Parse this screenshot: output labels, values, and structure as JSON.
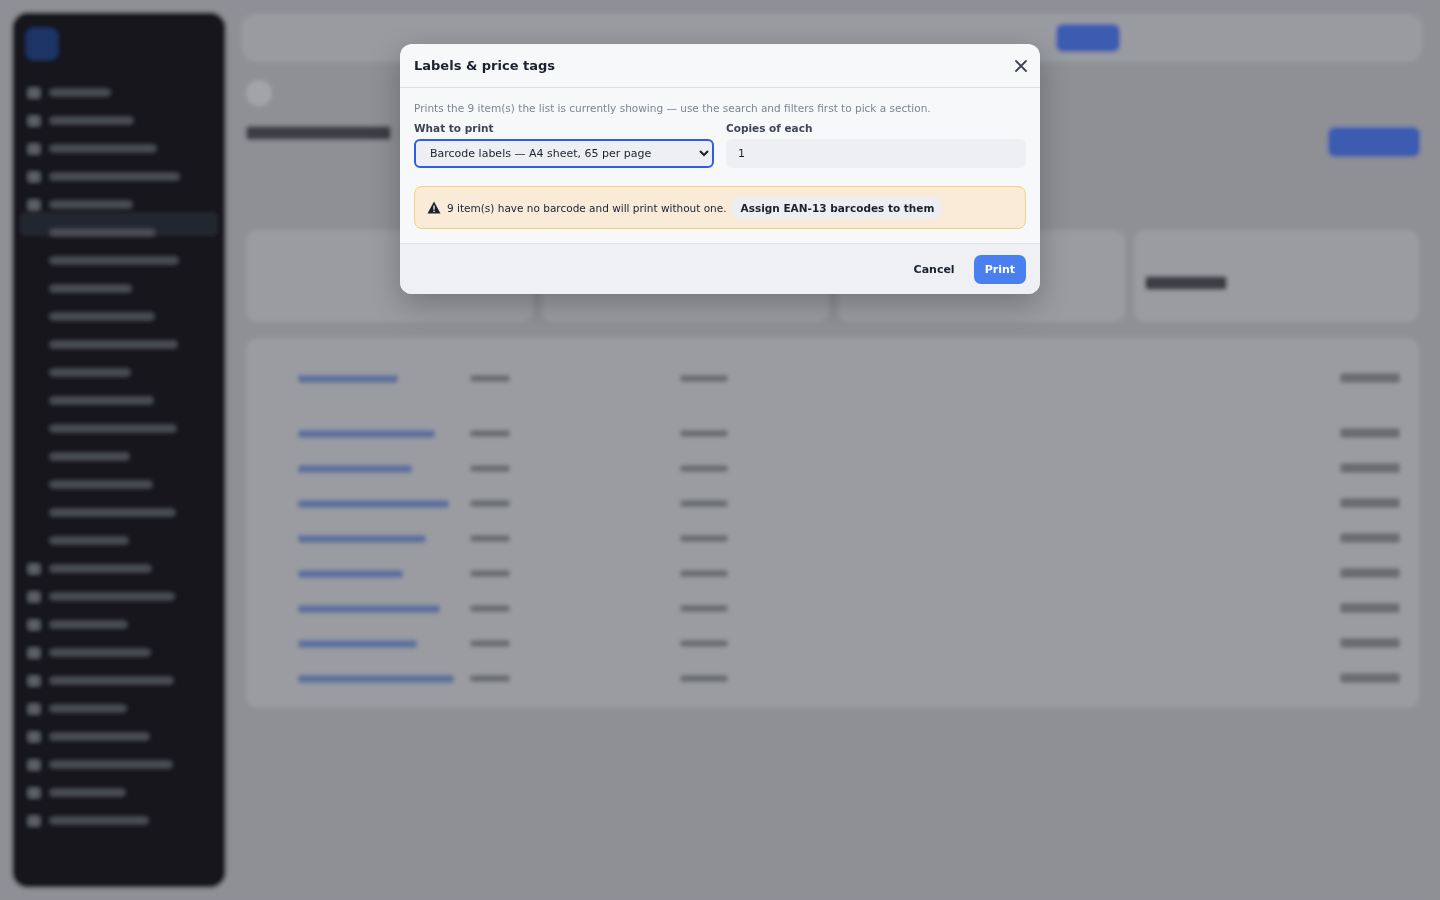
{
  "dialog": {
    "title": "Labels & price tags",
    "description": "Prints the 9 item(s) the list is currently showing — use the search and filters first to pick a section.",
    "fields": [
      {
        "kind": "select",
        "label": "What to print",
        "value": "Barcode labels — A4 sheet, 65 per page",
        "focused": true
      },
      {
        "kind": "input",
        "label": "Copies of each",
        "value": "1",
        "focused": false
      }
    ],
    "warning": {
      "text": "9 item(s) have no barcode and will print without one.",
      "action": "Assign EAN-13 barcodes to them"
    },
    "buttons": [
      {
        "label": "Cancel",
        "kind": "secondary"
      },
      {
        "label": "Print",
        "kind": "primary"
      }
    ]
  }
}
